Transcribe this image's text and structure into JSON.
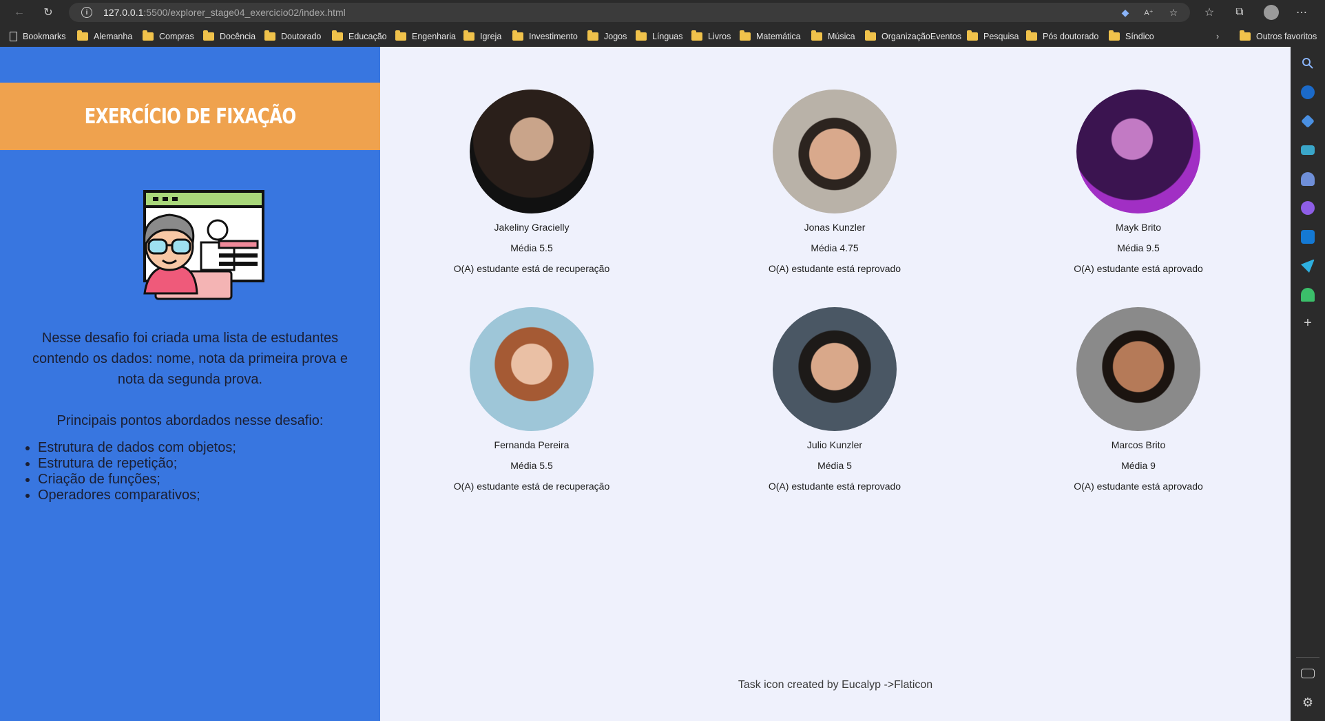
{
  "browser": {
    "url_host": "127.0.0.1",
    "url_path": ":5500/explorer_stage04_exercicio02/index.html",
    "bookmarks": [
      "Bookmarks",
      "Alemanha",
      "Compras",
      "Docência",
      "Doutorado",
      "Educação",
      "Engenharia",
      "Igreja",
      "Investimento",
      "Jogos",
      "Línguas",
      "Livros",
      "Matemática",
      "Música",
      "OrganizaçãoEventos",
      "Pesquisa",
      "Pós doutorado",
      "Síndico"
    ],
    "other_favorites": "Outros favoritos"
  },
  "sidebar": {
    "title": "EXERCÍCIO DE FIXAÇÃO",
    "description": "Nesse desafio foi criada uma lista de estudantes contendo os dados: nome, nota da primeira prova e nota da segunda prova.",
    "points_title": "Principais pontos abordados nesse desafio:",
    "points": [
      "Estrutura de dados com objetos;",
      "Estrutura de repetição;",
      "Criação de funções;",
      "Operadores comparativos;"
    ]
  },
  "students": [
    {
      "name": "Jakeliny Gracielly",
      "average": "Média 5.5",
      "status": "O(A) estudante está de recuperação"
    },
    {
      "name": "Jonas Kunzler",
      "average": "Média 4.75",
      "status": "O(A) estudante está reprovado"
    },
    {
      "name": "Mayk Brito",
      "average": "Média 9.5",
      "status": "O(A) estudante está aprovado"
    },
    {
      "name": "Fernanda Pereira",
      "average": "Média 5.5",
      "status": "O(A) estudante está de recuperação"
    },
    {
      "name": "Julio Kunzler",
      "average": "Média 5",
      "status": "O(A) estudante está reprovado"
    },
    {
      "name": "Marcos Brito",
      "average": "Média 9",
      "status": "O(A) estudante está aprovado"
    }
  ],
  "footer": "Task icon created by Eucalyp ->Flaticon",
  "colors": {
    "sidebar_bg": "#3876e0",
    "title_bg": "#efa24e",
    "main_bg": "#eff1fc"
  }
}
